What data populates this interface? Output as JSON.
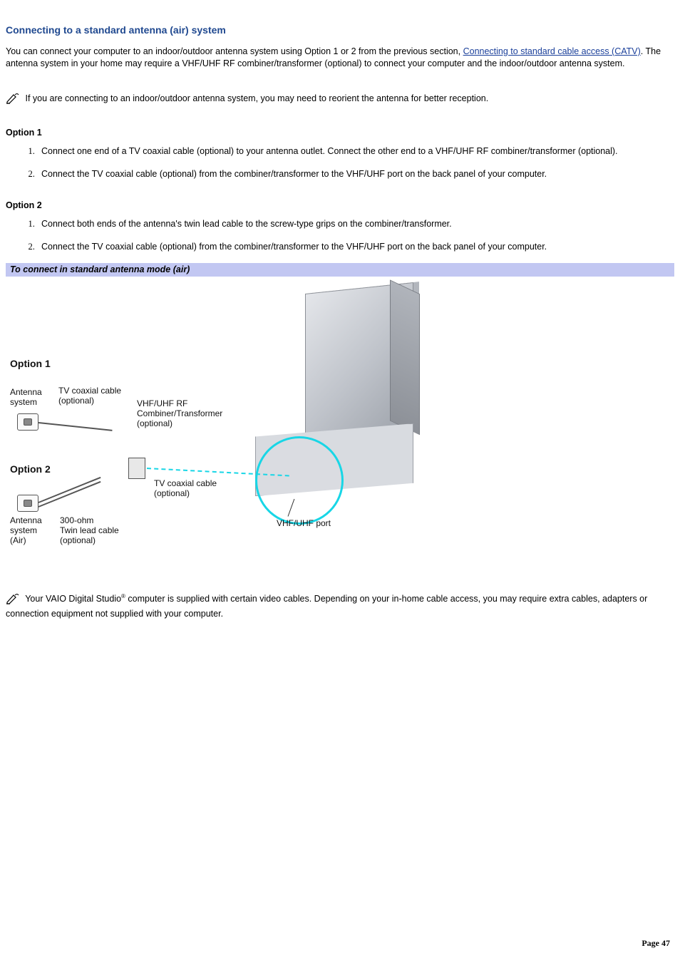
{
  "title": "Connecting to a standard antenna (air) system",
  "intro": {
    "pre_link": "You can connect your computer to an indoor/outdoor antenna system using Option 1 or 2 from the previous section, ",
    "link_text": "Connecting to standard cable access (CATV)",
    "post_link": ". The antenna system in your home may require a VHF/UHF RF combiner/transformer (optional) to connect your computer and the indoor/outdoor antenna system."
  },
  "note1": " If you are connecting to an indoor/outdoor antenna system, you may need to reorient the antenna for better reception.",
  "option1": {
    "heading": "Option 1",
    "steps": [
      "Connect one end of a TV coaxial cable (optional) to your antenna outlet. Connect the other end to a VHF/UHF RF combiner/transformer (optional).",
      "Connect the TV coaxial cable (optional) from the combiner/transformer to the VHF/UHF port on the back panel of your computer."
    ]
  },
  "option2": {
    "heading": "Option 2",
    "steps": [
      "Connect both ends of the antenna's twin lead cable to the screw-type grips on the combiner/transformer.",
      "Connect the TV coaxial cable (optional) from the combiner/transformer to the VHF/UHF port on the back panel of your computer."
    ]
  },
  "figure": {
    "caption": "To connect in standard antenna mode (air)",
    "labels": {
      "opt1": "Option 1",
      "opt2": "Option 2",
      "ant_sys": "Antenna\nsystem",
      "ant_sys_air": "Antenna\nsystem\n(Air)",
      "tv_coax": "TV coaxial cable\n(optional)",
      "combiner": "VHF/UHF RF\nCombiner/Transformer\n(optional)",
      "tv_coax2": "TV coaxial cable\n(optional)",
      "twin_lead": "300-ohm\nTwin lead cable\n(optional)",
      "vhf_port": "VHF/UHF port"
    }
  },
  "note2": {
    "pre": " Your VAIO Digital Studio",
    "reg": "®",
    "post": " computer is supplied with certain video cables. Depending on your in-home cable access, you may require extra cables, adapters or connection equipment not supplied with your computer."
  },
  "page_num": "Page 47"
}
